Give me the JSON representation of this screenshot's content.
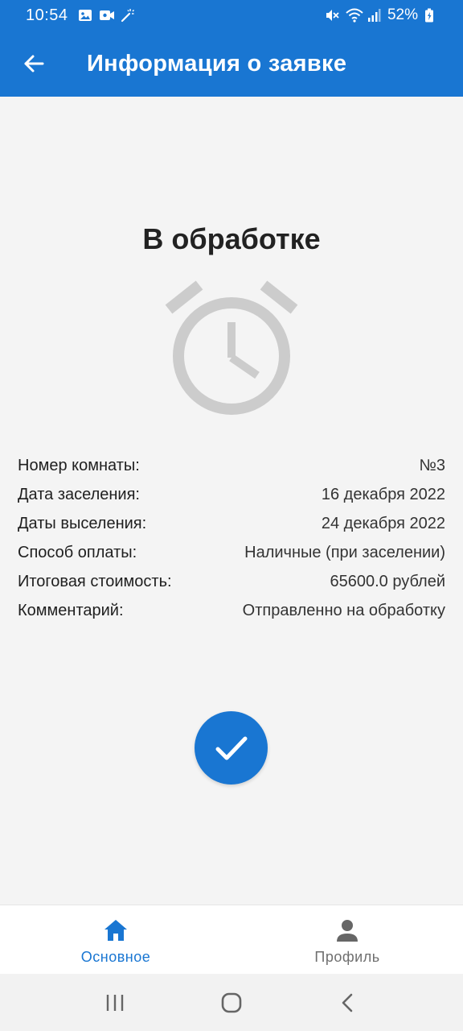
{
  "status_bar": {
    "time": "10:54",
    "battery": "52%",
    "icons_left": [
      "image-icon",
      "video-camera-icon",
      "magic-wand-icon"
    ],
    "icons_right": [
      "mute-icon",
      "wifi-icon",
      "signal-icon",
      "battery-icon"
    ]
  },
  "app_bar": {
    "title": "Информация о заявке",
    "back_icon": "arrow-back-icon"
  },
  "main": {
    "status": "В обработке",
    "status_icon": "alarm-clock-icon",
    "details": [
      {
        "label": "Номер комнаты:",
        "value": "№3"
      },
      {
        "label": "Дата заселения:",
        "value": "16 декабря 2022"
      },
      {
        "label": "Даты выселения:",
        "value": "24 декабря 2022"
      },
      {
        "label": "Способ оплаты:",
        "value": "Наличные (при заселении)"
      },
      {
        "label": "Итоговая стоимость:",
        "value": "65600.0 рублей"
      },
      {
        "label": "Комментарий:",
        "value": "Отправленно на обработку"
      }
    ],
    "confirm_icon": "check-icon"
  },
  "bottom_nav": {
    "items": [
      {
        "label": "Основное",
        "icon": "home-icon",
        "active": true
      },
      {
        "label": "Профиль",
        "icon": "person-icon",
        "active": false
      }
    ]
  },
  "colors": {
    "primary": "#1976d2",
    "background": "#f4f4f4",
    "clock_grey": "#cccccc"
  }
}
